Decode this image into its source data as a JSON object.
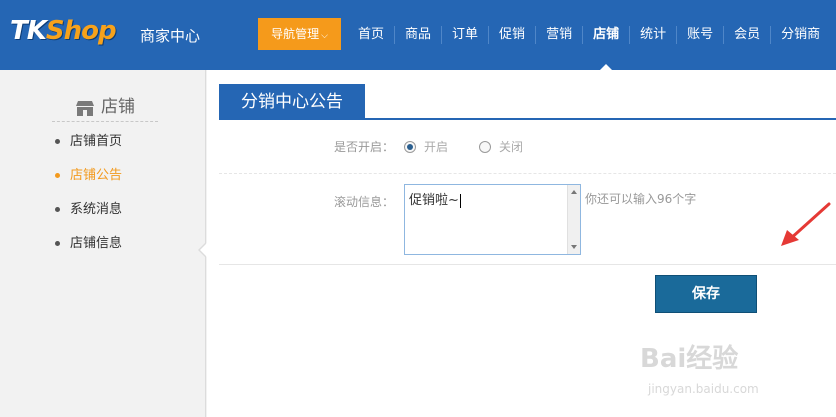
{
  "header": {
    "logo_tk": "TK",
    "logo_shop": "Shop",
    "merchant_center": "商家中心",
    "nav_manage": "导航管理",
    "nav_items": [
      "首页",
      "商品",
      "订单",
      "促销",
      "营销",
      "店铺",
      "统计",
      "账号",
      "会员",
      "分销商"
    ],
    "active_index": 5
  },
  "sidebar": {
    "title": "店铺",
    "items": [
      "店铺首页",
      "店铺公告",
      "系统消息",
      "店铺信息"
    ],
    "active_index": 1
  },
  "main": {
    "tab_title": "分销中心公告",
    "enable_label": "是否开启：",
    "radio_on": "开启",
    "radio_off": "关闭",
    "radio_selected": "开启",
    "scroll_label": "滚动信息：",
    "scroll_value": "促销啦~",
    "hint": "你还可以输入96个字",
    "save_label": "保存"
  },
  "watermark": {
    "line1": "Bai经验",
    "line2": "jingyan.baidu.com"
  },
  "colors": {
    "topbar": "#2566b4",
    "accent_orange": "#f59a1b",
    "save_button": "#1a6a9a",
    "annotation_arrow": "#e53935"
  }
}
